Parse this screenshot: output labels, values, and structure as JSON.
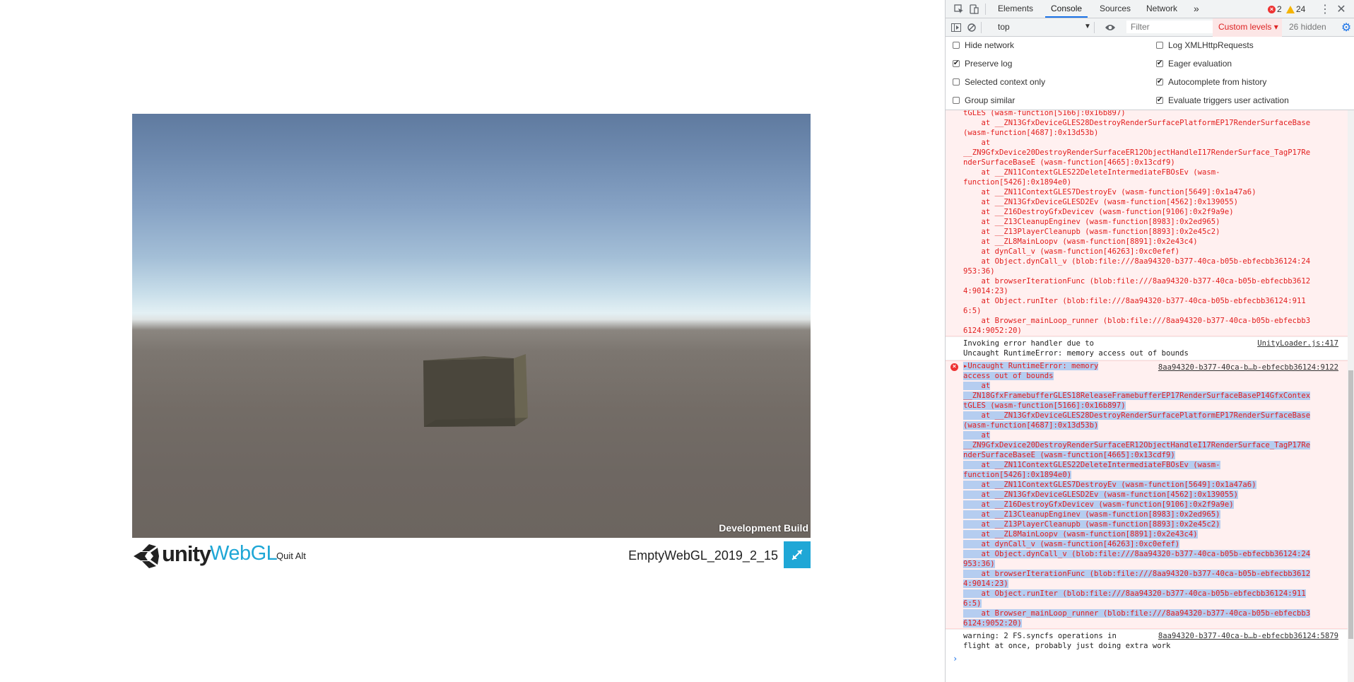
{
  "page": {
    "dev_build": "Development Build",
    "unity_label": "unity",
    "webgl_label": "WebGL",
    "quit_alt": "Quit Alt",
    "game_title": "EmptyWebGL_2019_2_15",
    "fullscreen_icon": "fullscreen-arrows-icon"
  },
  "devtools": {
    "tabs": [
      "Elements",
      "Console",
      "Sources",
      "Network"
    ],
    "active_tab": "Console",
    "more_tabs": "»",
    "error_count": "2",
    "warning_count": "24",
    "context": "top",
    "filter_placeholder": "Filter",
    "levels_label": "Custom levels ▾",
    "hidden_count": "26 hidden",
    "settings": [
      {
        "label": "Hide network",
        "checked": false
      },
      {
        "label": "Log XMLHttpRequests",
        "checked": false
      },
      {
        "label": "Preserve log",
        "checked": true
      },
      {
        "label": "Eager evaluation",
        "checked": true
      },
      {
        "label": "Selected context only",
        "checked": false
      },
      {
        "label": "Autocomplete from history",
        "checked": true
      },
      {
        "label": "Group similar",
        "checked": false
      },
      {
        "label": "Evaluate triggers user activation",
        "checked": true
      }
    ],
    "messages": {
      "error1_lines": [
        "tGLES (wasm-function[5166]:0x16b897)",
        "    at __ZN13GfxDeviceGLES28DestroyRenderSurfacePlatformEP17RenderSurfaceBase",
        "(wasm-function[4687]:0x13d53b)",
        "    at",
        "__ZN9GfxDevice20DestroyRenderSurfaceER12ObjectHandleI17RenderSurface_TagP17Re",
        "nderSurfaceBaseE (wasm-function[4665]:0x13cdf9)",
        "    at __ZN11ContextGLES22DeleteIntermediateFBOsEv (wasm-",
        "function[5426]:0x1894e0)",
        "    at __ZN11ContextGLES7DestroyEv (wasm-function[5649]:0x1a47a6)",
        "    at __ZN13GfxDeviceGLESD2Ev (wasm-function[4562]:0x139055)",
        "    at __Z16DestroyGfxDevicev (wasm-function[9106]:0x2f9a9e)",
        "    at __Z13CleanupEnginev (wasm-function[8983]:0x2ed965)",
        "    at __Z13PlayerCleanupb (wasm-function[8893]:0x2e45c2)",
        "    at __ZL8MainLoopv (wasm-function[8891]:0x2e43c4)",
        "    at dynCall_v (wasm-function[46263]:0xc0efef)",
        "    at Object.dynCall_v (blob:file:///8aa94320-b377-40ca-b05b-ebfecbb36124:24",
        "953:36)",
        "    at browserIterationFunc (blob:file:///8aa94320-b377-40ca-b05b-ebfecbb3612",
        "4:9014:23)",
        "    at Object.runIter (blob:file:///8aa94320-b377-40ca-b05b-ebfecbb36124:911",
        "6:5)",
        "    at Browser_mainLoop_runner (blob:file:///8aa94320-b377-40ca-b05b-ebfecbb3",
        "6124:9052:20)"
      ],
      "info_lines": [
        "Invoking error handler due to",
        "Uncaught RuntimeError: memory access out of bounds"
      ],
      "info_source": "UnityLoader.js:417",
      "error2_source": "8aa94320-b377-40ca-b…b-ebfecbb36124:9122",
      "error2_lines": [
        "Uncaught RuntimeError: memory",
        "access out of bounds",
        "    at",
        "__ZN18GfxFramebufferGLES18ReleaseFramebufferEP17RenderSurfaceBaseP14GfxContex",
        "tGLES (wasm-function[5166]:0x16b897)",
        "    at __ZN13GfxDeviceGLES28DestroyRenderSurfacePlatformEP17RenderSurfaceBase",
        "(wasm-function[4687]:0x13d53b)",
        "    at",
        "__ZN9GfxDevice20DestroyRenderSurfaceER12ObjectHandleI17RenderSurface_TagP17Re",
        "nderSurfaceBaseE (wasm-function[4665]:0x13cdf9)",
        "    at __ZN11ContextGLES22DeleteIntermediateFBOsEv (wasm-",
        "function[5426]:0x1894e0)",
        "    at __ZN11ContextGLES7DestroyEv (wasm-function[5649]:0x1a47a6)",
        "    at __ZN13GfxDeviceGLESD2Ev (wasm-function[4562]:0x139055)",
        "    at __Z16DestroyGfxDevicev (wasm-function[9106]:0x2f9a9e)",
        "    at __Z13CleanupEnginev (wasm-function[8983]:0x2ed965)",
        "    at __Z13PlayerCleanupb (wasm-function[8893]:0x2e45c2)",
        "    at __ZL8MainLoopv (wasm-function[8891]:0x2e43c4)",
        "    at dynCall_v (wasm-function[46263]:0xc0efef)",
        "    at Object.dynCall_v (blob:file:///8aa94320-b377-40ca-b05b-ebfecbb36124:24",
        "953:36)",
        "    at browserIterationFunc (blob:file:///8aa94320-b377-40ca-b05b-ebfecbb3612",
        "4:9014:23)",
        "    at Object.runIter (blob:file:///8aa94320-b377-40ca-b05b-ebfecbb36124:911",
        "6:5)",
        "    at Browser_mainLoop_runner (blob:file:///8aa94320-b377-40ca-b05b-ebfecbb3",
        "6124:9052:20)"
      ],
      "warn_lines": [
        "warning: 2 FS.syncfs operations in",
        "flight at once, probably just doing extra work"
      ],
      "warn_source": "8aa94320-b377-40ca-b…b-ebfecbb36124:5879",
      "prompt": "›"
    }
  }
}
